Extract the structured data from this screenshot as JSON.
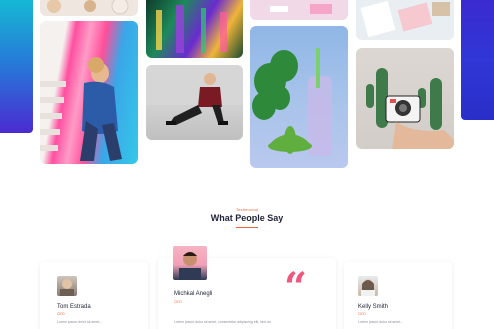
{
  "testimonials": {
    "kicker": "Testimonial",
    "title": "What People Say",
    "accent_color": "#f0643c",
    "quote_glyph": "“",
    "items": [
      {
        "name": "Tom Estrada",
        "role": "CEO",
        "text": "Lorem ipsum dolor sit amet..."
      },
      {
        "name": "Michkal Anegli",
        "role": "CEO",
        "text": "Lorem ipsum dolor sit amet, consectetur adipiscing elit, sed do"
      },
      {
        "name": "Kelly Smith",
        "role": "CEO",
        "text": "Lorem ipsum dolor sit amet..."
      }
    ]
  },
  "gallery": {
    "tiles": [
      "food-photo",
      "neon-street-photo",
      "pink-desk-photo",
      "flatlay-photo",
      "stairs-person-photo",
      "sitting-man-photo",
      "plant-bottle-photo",
      "cactus-camera-photo"
    ]
  },
  "colors": {
    "bar_left_start": "#15b9d4",
    "bar_right": "#2f37d6",
    "quote": "#f0577f"
  }
}
